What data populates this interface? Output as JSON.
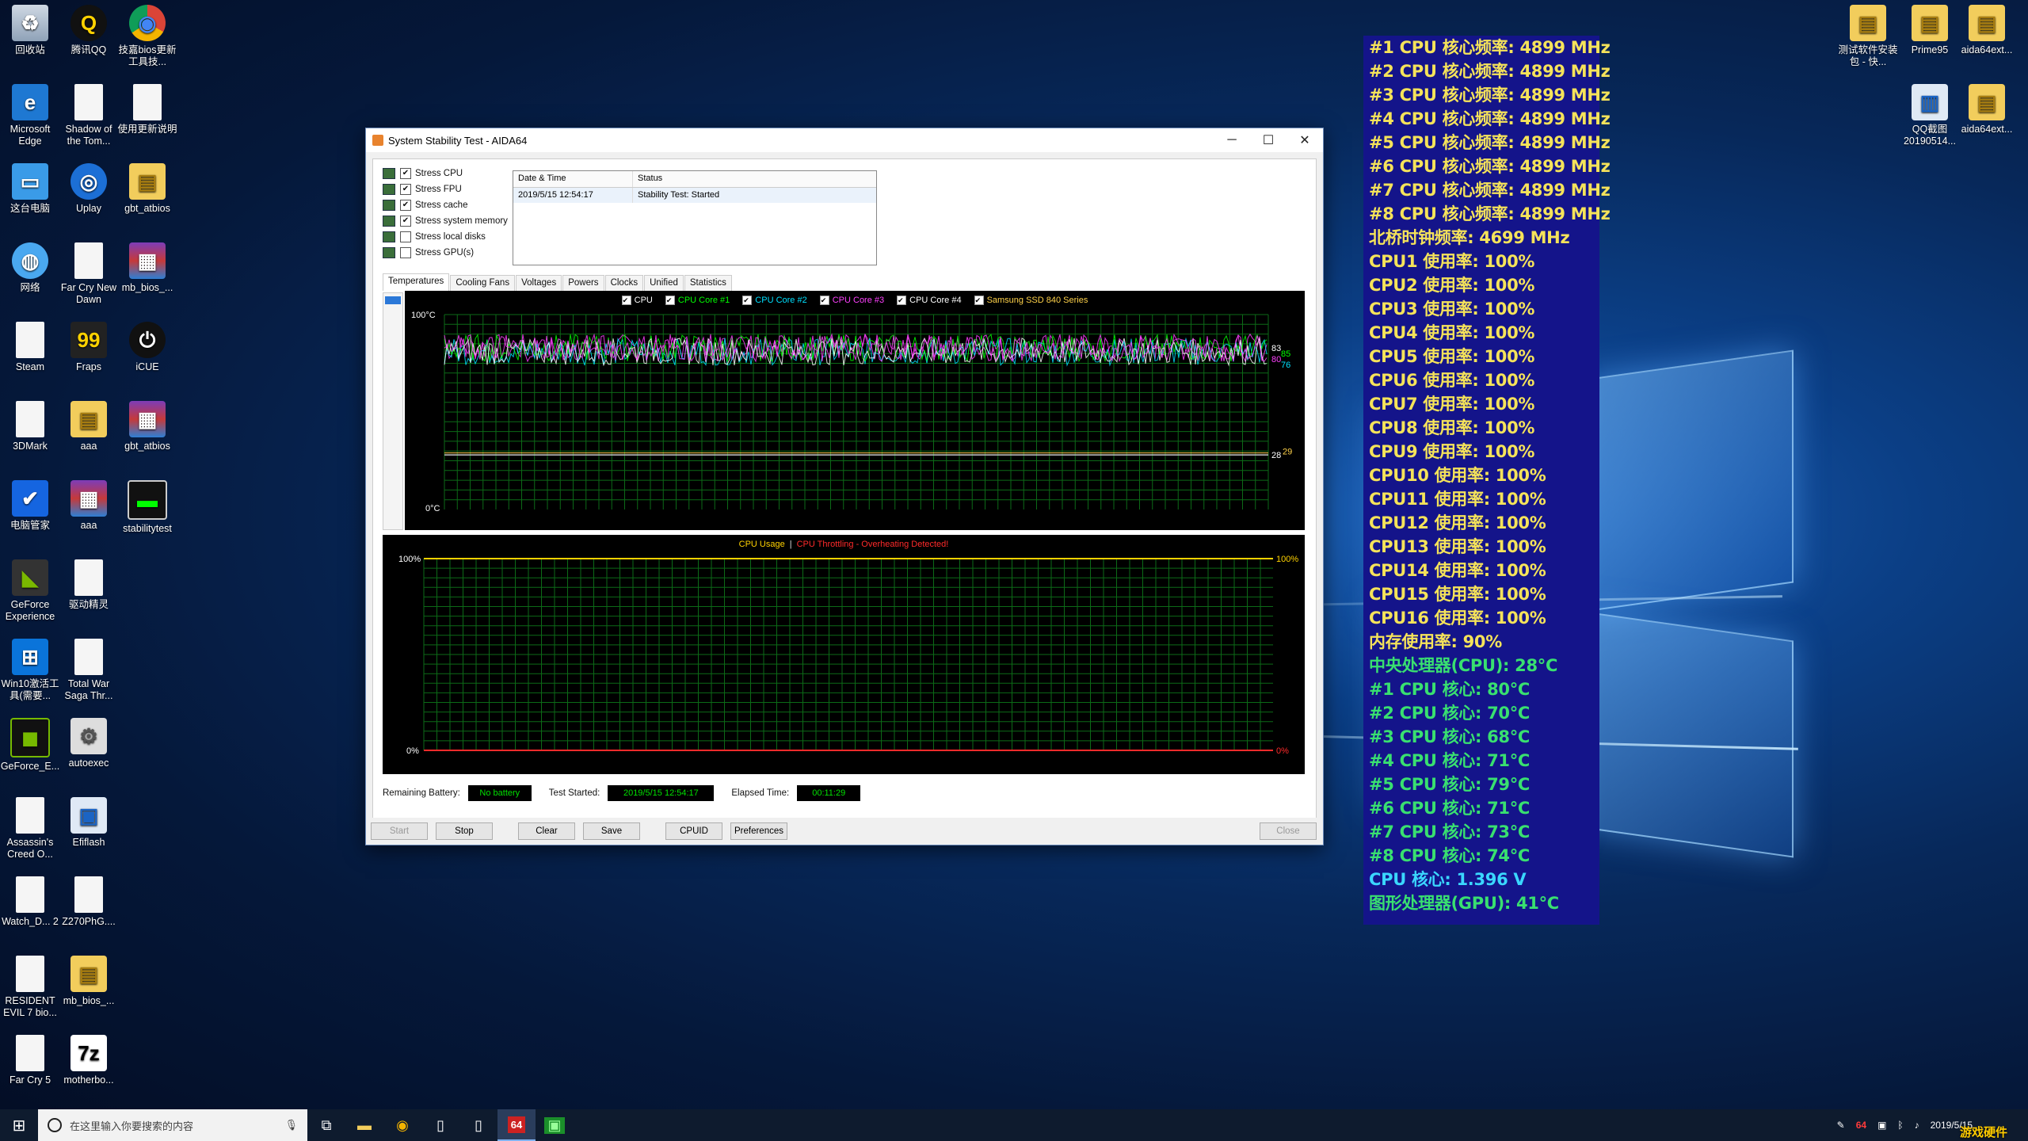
{
  "desktop": {
    "icons_left": [
      {
        "label": "回收站",
        "glyph": "♻",
        "cls": "g-bin",
        "col": 0,
        "row": 0
      },
      {
        "label": "腾讯QQ",
        "glyph": "Q",
        "cls": "g-qq",
        "col": 1,
        "row": 0
      },
      {
        "label": "技嘉bios更新工具技...",
        "glyph": "◉",
        "cls": "g-chrome",
        "col": 2,
        "row": 0
      },
      {
        "label": "Microsoft Edge",
        "glyph": "e",
        "cls": "g-edge",
        "col": 0,
        "row": 1
      },
      {
        "label": "Shadow of the Tom...",
        "glyph": "",
        "cls": "g-doc",
        "col": 1,
        "row": 1
      },
      {
        "label": "使用更新说明",
        "glyph": "",
        "cls": "g-doc",
        "col": 2,
        "row": 1
      },
      {
        "label": "这台电脑",
        "glyph": "▭",
        "cls": "g-pc",
        "col": 0,
        "row": 2
      },
      {
        "label": "Uplay",
        "glyph": "◎",
        "cls": "g-uplay",
        "col": 1,
        "row": 2
      },
      {
        "label": "gbt_atbios",
        "glyph": "▤",
        "cls": "g-folder",
        "col": 2,
        "row": 2
      },
      {
        "label": "网络",
        "glyph": "◍",
        "cls": "g-net",
        "col": 0,
        "row": 3
      },
      {
        "label": "Far Cry New Dawn",
        "glyph": "",
        "cls": "g-doc",
        "col": 1,
        "row": 3
      },
      {
        "label": "mb_bios_...",
        "glyph": "▦",
        "cls": "g-rar",
        "col": 2,
        "row": 3
      },
      {
        "label": "Steam",
        "glyph": "",
        "cls": "g-doc",
        "col": 0,
        "row": 4
      },
      {
        "label": "Fraps",
        "glyph": "99",
        "cls": "g-fraps",
        "col": 1,
        "row": 4
      },
      {
        "label": "iCUE",
        "glyph": "⏻",
        "cls": "g-icue",
        "col": 2,
        "row": 4
      },
      {
        "label": "3DMark",
        "glyph": "",
        "cls": "g-doc",
        "col": 0,
        "row": 5
      },
      {
        "label": "aaa",
        "glyph": "▤",
        "cls": "g-folder",
        "col": 1,
        "row": 5
      },
      {
        "label": "gbt_atbios",
        "glyph": "▦",
        "cls": "g-rar",
        "col": 2,
        "row": 5
      },
      {
        "label": "电脑管家",
        "glyph": "✔",
        "cls": "g-shield",
        "col": 0,
        "row": 6
      },
      {
        "label": "aaa",
        "glyph": "▦",
        "cls": "g-rar",
        "col": 1,
        "row": 6
      },
      {
        "label": "stabilitytest",
        "glyph": "▬",
        "cls": "g-term",
        "col": 2,
        "row": 6
      },
      {
        "label": "GeForce Experience",
        "glyph": "◣",
        "cls": "g-gf",
        "col": 0,
        "row": 7
      },
      {
        "label": "驱动精灵",
        "glyph": "",
        "cls": "g-doc",
        "col": 1,
        "row": 7
      },
      {
        "label": "Win10激活工具(需要...",
        "glyph": "⊞",
        "cls": "g-win",
        "col": 0,
        "row": 8
      },
      {
        "label": "Total War Saga Thr...",
        "glyph": "",
        "cls": "g-doc",
        "col": 1,
        "row": 8
      },
      {
        "label": "GeForce_E...",
        "glyph": "◼",
        "cls": "g-nv",
        "col": 0,
        "row": 9
      },
      {
        "label": "autoexec",
        "glyph": "⚙",
        "cls": "g-gear",
        "col": 1,
        "row": 9
      },
      {
        "label": "Assassin's Creed O...",
        "glyph": "",
        "cls": "g-doc",
        "col": 0,
        "row": 10
      },
      {
        "label": "Efiflash",
        "glyph": "▣",
        "cls": "g-efi",
        "col": 1,
        "row": 10
      },
      {
        "label": "Watch_D... 2",
        "glyph": "",
        "cls": "g-doc",
        "col": 0,
        "row": 11
      },
      {
        "label": "Z270PhG....",
        "glyph": "",
        "cls": "g-doc",
        "col": 1,
        "row": 11
      },
      {
        "label": "RESIDENT EVIL 7 bio...",
        "glyph": "",
        "cls": "g-doc",
        "col": 0,
        "row": 12
      },
      {
        "label": "mb_bios_...",
        "glyph": "▤",
        "cls": "g-folder",
        "col": 1,
        "row": 12
      },
      {
        "label": "Far Cry 5",
        "glyph": "",
        "cls": "g-doc",
        "col": 0,
        "row": 13
      },
      {
        "label": "motherbo...",
        "glyph": "7z",
        "cls": "g-7z",
        "col": 1,
        "row": 13
      }
    ],
    "icons_right": [
      {
        "label": "测试软件安装包 - 快...",
        "glyph": "▤",
        "cls": "g-folder"
      },
      {
        "label": "Prime95",
        "glyph": "▤",
        "cls": "g-folder"
      },
      {
        "label": "aida64ext...",
        "glyph": "▤",
        "cls": "g-folder"
      },
      {
        "label": "QQ截图20190514...",
        "glyph": "▥",
        "cls": "g-efi"
      },
      {
        "label": "aida64ext...",
        "glyph": "▤",
        "cls": "g-folder"
      }
    ]
  },
  "window": {
    "title": "System Stability Test - AIDA64",
    "controls": {
      "minimize": "─",
      "maximize": "☐",
      "close": "✕"
    },
    "stress_options": [
      {
        "label": "Stress CPU",
        "checked": true
      },
      {
        "label": "Stress FPU",
        "checked": true
      },
      {
        "label": "Stress cache",
        "checked": true
      },
      {
        "label": "Stress system memory",
        "checked": true
      },
      {
        "label": "Stress local disks",
        "checked": false
      },
      {
        "label": "Stress GPU(s)",
        "checked": false
      }
    ],
    "log": {
      "col_datetime": "Date & Time",
      "col_status": "Status",
      "rows": [
        {
          "datetime": "2019/5/15 12:54:17",
          "status": "Stability Test: Started"
        }
      ]
    },
    "tabs": [
      "Temperatures",
      "Cooling Fans",
      "Voltages",
      "Powers",
      "Clocks",
      "Unified",
      "Statistics"
    ],
    "active_tab": "Temperatures",
    "temp_graph": {
      "legend": [
        {
          "label": "CPU",
          "color": "#ffffff"
        },
        {
          "label": "CPU Core #1",
          "color": "#00ff00"
        },
        {
          "label": "CPU Core #2",
          "color": "#00e0ff"
        },
        {
          "label": "CPU Core #3",
          "color": "#ff40ff"
        },
        {
          "label": "CPU Core #4",
          "color": "#ffffff"
        },
        {
          "label": "Samsung SSD 840 Series",
          "color": "#ffd24a"
        }
      ],
      "y_top_label": "100°C",
      "y_bottom_label": "0°C",
      "right_labels_top": [
        "83",
        "85",
        "80",
        "76"
      ],
      "right_labels_low": [
        "28",
        "29"
      ]
    },
    "usage_graph": {
      "title": "CPU Usage",
      "separator": "|",
      "throttling": "CPU Throttling - Overheating Detected!",
      "y_top_left": "100%",
      "y_bottom_left": "0%",
      "y_top_right": "100%",
      "y_bottom_right": "0%"
    },
    "status_bar": {
      "battery_label": "Remaining Battery:",
      "battery_value": "No battery",
      "started_label": "Test Started:",
      "started_value": "2019/5/15 12:54:17",
      "elapsed_label": "Elapsed Time:",
      "elapsed_value": "00:11:29"
    },
    "buttons": {
      "start": "Start",
      "stop": "Stop",
      "clear": "Clear",
      "save": "Save",
      "cpuid": "CPUID",
      "preferences": "Preferences",
      "close": "Close"
    }
  },
  "osd": {
    "lines": [
      {
        "text": "#1 CPU 核心频率: 4899 MHz",
        "color": "#f5e35a"
      },
      {
        "text": "#2 CPU 核心频率: 4899 MHz",
        "color": "#f5e35a"
      },
      {
        "text": "#3 CPU 核心频率: 4899 MHz",
        "color": "#f5e35a"
      },
      {
        "text": "#4 CPU 核心频率: 4899 MHz",
        "color": "#f5e35a"
      },
      {
        "text": "#5 CPU 核心频率: 4899 MHz",
        "color": "#f5e35a"
      },
      {
        "text": "#6 CPU 核心频率: 4899 MHz",
        "color": "#f5e35a"
      },
      {
        "text": "#7 CPU 核心频率: 4899 MHz",
        "color": "#f5e35a"
      },
      {
        "text": "#8 CPU 核心频率: 4899 MHz",
        "color": "#f5e35a"
      },
      {
        "text": "北桥时钟频率: 4699 MHz",
        "color": "#f5e35a"
      },
      {
        "text": "CPU1 使用率: 100%",
        "color": "#f5e35a"
      },
      {
        "text": "CPU2 使用率: 100%",
        "color": "#f5e35a"
      },
      {
        "text": "CPU3 使用率: 100%",
        "color": "#f5e35a"
      },
      {
        "text": "CPU4 使用率: 100%",
        "color": "#f5e35a"
      },
      {
        "text": "CPU5 使用率: 100%",
        "color": "#f5e35a"
      },
      {
        "text": "CPU6 使用率: 100%",
        "color": "#f5e35a"
      },
      {
        "text": "CPU7 使用率: 100%",
        "color": "#f5e35a"
      },
      {
        "text": "CPU8 使用率: 100%",
        "color": "#f5e35a"
      },
      {
        "text": "CPU9 使用率: 100%",
        "color": "#f5e35a"
      },
      {
        "text": "CPU10 使用率: 100%",
        "color": "#f5e35a"
      },
      {
        "text": "CPU11 使用率: 100%",
        "color": "#f5e35a"
      },
      {
        "text": "CPU12 使用率: 100%",
        "color": "#f5e35a"
      },
      {
        "text": "CPU13 使用率: 100%",
        "color": "#f5e35a"
      },
      {
        "text": "CPU14 使用率: 100%",
        "color": "#f5e35a"
      },
      {
        "text": "CPU15 使用率: 100%",
        "color": "#f5e35a"
      },
      {
        "text": "CPU16 使用率: 100%",
        "color": "#f5e35a"
      },
      {
        "text": "内存使用率: 90%",
        "color": "#f5e35a"
      },
      {
        "text": "中央处理器(CPU): 28°C",
        "color": "#39e070"
      },
      {
        "text": " #1 CPU 核心: 80°C",
        "color": "#39e070"
      },
      {
        "text": " #2 CPU 核心: 70°C",
        "color": "#39e070"
      },
      {
        "text": " #3 CPU 核心: 68°C",
        "color": "#39e070"
      },
      {
        "text": " #4 CPU 核心: 71°C",
        "color": "#39e070"
      },
      {
        "text": " #5 CPU 核心: 79°C",
        "color": "#39e070"
      },
      {
        "text": " #6 CPU 核心: 71°C",
        "color": "#39e070"
      },
      {
        "text": " #7 CPU 核心: 73°C",
        "color": "#39e070"
      },
      {
        "text": " #8 CPU 核心: 74°C",
        "color": "#39e070"
      },
      {
        "text": "CPU 核心: 1.396 V",
        "color": "#3ad7ff"
      },
      {
        "text": "图形处理器(GPU): 41°C",
        "color": "#39e070"
      }
    ]
  },
  "taskbar": {
    "search_placeholder": "在这里输入你要搜索的内容",
    "apps": [
      {
        "name": "task-view",
        "glyph": "⧉"
      },
      {
        "name": "file-explorer",
        "glyph": "▬"
      },
      {
        "name": "chrome",
        "glyph": "◉"
      },
      {
        "name": "document",
        "glyph": "▯"
      },
      {
        "name": "document-2",
        "glyph": "▯"
      },
      {
        "name": "aida64",
        "glyph": "64"
      },
      {
        "name": "monitor-app",
        "glyph": "▣"
      }
    ],
    "tray_date": "2019/5/15",
    "watermark": "游戏硬件"
  }
}
